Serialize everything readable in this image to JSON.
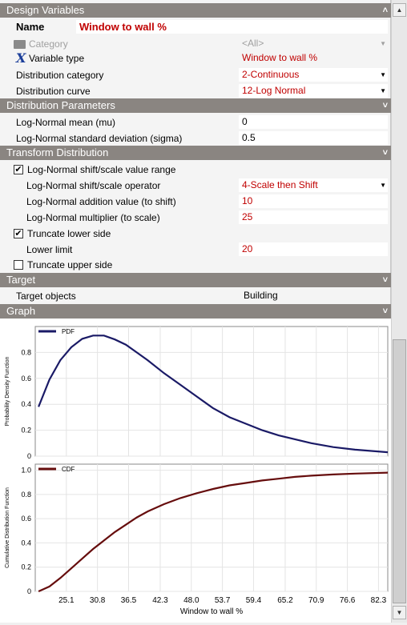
{
  "sections": {
    "design_variables": "Design Variables",
    "distribution_parameters": "Distribution Parameters",
    "transform_distribution": "Transform Distribution",
    "target": "Target",
    "graph": "Graph"
  },
  "design": {
    "name_label": "Name",
    "name_value": "Window to wall %",
    "category_label": "Category",
    "category_value": "<All>",
    "variable_type_label": "Variable type",
    "variable_type_value": "Window to wall %",
    "dist_category_label": "Distribution category",
    "dist_category_value": "2-Continuous",
    "dist_curve_label": "Distribution curve",
    "dist_curve_value": "12-Log Normal"
  },
  "params": {
    "mean_label": "Log-Normal mean (mu)",
    "mean_value": "0",
    "sd_label": "Log-Normal standard deviation (sigma)",
    "sd_value": "0.5"
  },
  "transform": {
    "shift_scale_label": "Log-Normal shift/scale value range",
    "shift_scale_checked": true,
    "operator_label": "Log-Normal shift/scale operator",
    "operator_value": "4-Scale then Shift",
    "addition_label": "Log-Normal addition value (to shift)",
    "addition_value": "10",
    "multiplier_label": "Log-Normal multiplier (to scale)",
    "multiplier_value": "25",
    "truncate_lower_label": "Truncate lower side",
    "truncate_lower_checked": true,
    "lower_limit_label": "Lower limit",
    "lower_limit_value": "20",
    "truncate_upper_label": "Truncate upper side",
    "truncate_upper_checked": false
  },
  "target": {
    "objects_label": "Target objects",
    "objects_value": "Building"
  },
  "chart_data": [
    {
      "type": "line",
      "legend": "PDF",
      "ylabel": "Probability Density Function",
      "ylim": [
        0,
        1.0
      ],
      "yticks": [
        "0",
        "0.2",
        "0.4",
        "0.6",
        "0.8"
      ],
      "x": [
        20.0,
        22.0,
        24.0,
        26.0,
        28.0,
        30.0,
        32.0,
        34.0,
        36.0,
        38.0,
        40.0,
        43.0,
        46.0,
        49.0,
        52.0,
        55.0,
        58.0,
        61.0,
        64.0,
        67.0,
        70.0,
        74.0,
        78.0,
        84.0
      ],
      "y": [
        0.38,
        0.59,
        0.74,
        0.84,
        0.905,
        0.93,
        0.93,
        0.9,
        0.86,
        0.8,
        0.74,
        0.64,
        0.55,
        0.46,
        0.37,
        0.3,
        0.25,
        0.2,
        0.16,
        0.13,
        0.1,
        0.07,
        0.05,
        0.03
      ],
      "color": "#1a1a66"
    },
    {
      "type": "line",
      "legend": "CDF",
      "ylabel": "Cumulative Distribution Function",
      "xlabel": "Window to wall %",
      "ylim": [
        0,
        1.05
      ],
      "yticks": [
        "0",
        "0.2",
        "0.4",
        "0.6",
        "0.8",
        "1.0"
      ],
      "xticks": [
        "25.1",
        "30.8",
        "36.5",
        "42.3",
        "48.0",
        "53.7",
        "59.4",
        "65.2",
        "70.9",
        "76.6",
        "82.3"
      ],
      "xlim": [
        19.4,
        84.0
      ],
      "x": [
        20.0,
        22.0,
        24.0,
        26.0,
        28.0,
        30.0,
        32.0,
        34.0,
        36.0,
        38.0,
        40.0,
        43.0,
        46.0,
        49.0,
        52.0,
        55.0,
        58.0,
        61.0,
        64.0,
        67.0,
        70.0,
        74.0,
        78.0,
        84.0
      ],
      "y": [
        0.0,
        0.04,
        0.11,
        0.19,
        0.27,
        0.35,
        0.42,
        0.49,
        0.55,
        0.61,
        0.66,
        0.72,
        0.77,
        0.81,
        0.845,
        0.875,
        0.895,
        0.915,
        0.93,
        0.945,
        0.955,
        0.965,
        0.972,
        0.98
      ],
      "color": "#660d0d"
    }
  ]
}
